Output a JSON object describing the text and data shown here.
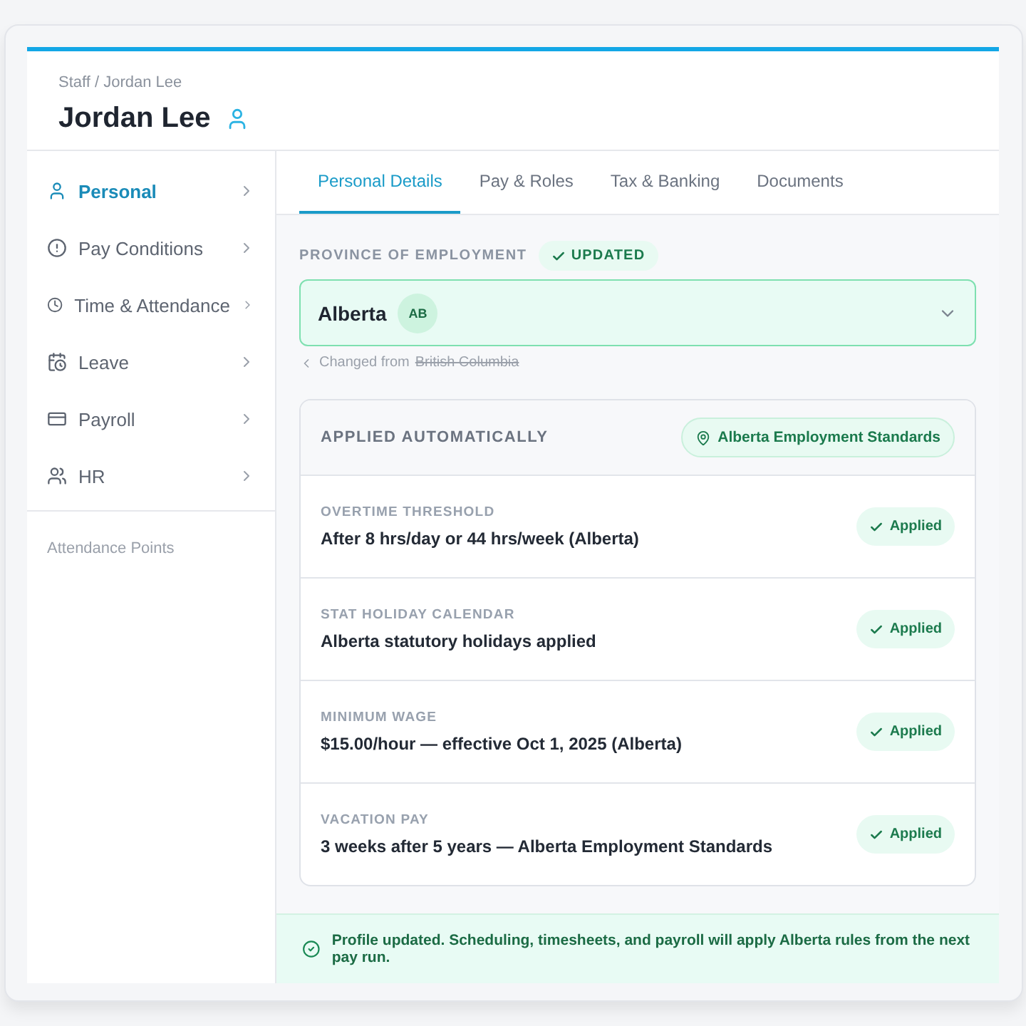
{
  "breadcrumb": "Staff / Jordan Lee",
  "title": "Jordan Lee",
  "sidebar": {
    "items": [
      {
        "label": "Personal",
        "selected": true
      },
      {
        "label": "Pay Conditions",
        "selected": false
      },
      {
        "label": "Time & Attendance",
        "selected": false
      },
      {
        "label": "Leave",
        "selected": false
      },
      {
        "label": "Payroll",
        "selected": false
      },
      {
        "label": "HR",
        "selected": false
      }
    ],
    "footer_link": "Attendance Points"
  },
  "tabs": [
    {
      "label": "Personal Details",
      "selected": true
    },
    {
      "label": "Pay & Roles",
      "selected": false
    },
    {
      "label": "Tax & Banking",
      "selected": false
    },
    {
      "label": "Documents",
      "selected": false
    }
  ],
  "province": {
    "label": "PROVINCE OF EMPLOYMENT",
    "badge": "UPDATED",
    "value": "Alberta",
    "code": "AB",
    "changed_label": "Changed from",
    "previous": "British Columbia"
  },
  "applied": {
    "title": "APPLIED AUTOMATICALLY",
    "standard": "Alberta Employment Standards",
    "rules": [
      {
        "label": "OVERTIME THRESHOLD",
        "value": "After 8 hrs/day or 44 hrs/week (Alberta)",
        "status": "Applied"
      },
      {
        "label": "STAT HOLIDAY CALENDAR",
        "value": "Alberta statutory holidays applied",
        "status": "Applied"
      },
      {
        "label": "MINIMUM WAGE",
        "value": "$15.00/hour — effective Oct 1, 2025 (Alberta)",
        "status": "Applied"
      },
      {
        "label": "VACATION PAY",
        "value": "3 weeks after 5 years — Alberta Employment Standards",
        "status": "Applied"
      }
    ]
  },
  "banner": "Profile updated. Scheduling, timesheets, and payroll will apply Alberta rules from the next pay run."
}
